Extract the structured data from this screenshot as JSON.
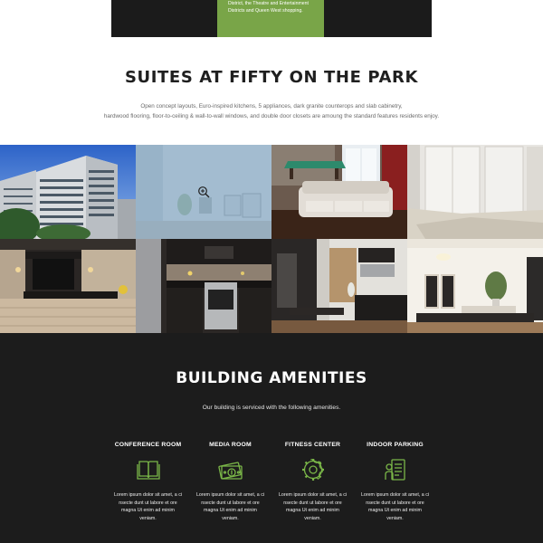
{
  "top_banner": {
    "text": "District, the Theatre and Entertainment Districts and Queen West shopping."
  },
  "suites": {
    "title": "SUITES AT FIFTY ON THE PARK",
    "description_line1": "Open concept layouts, Euro-inspired kitchens, 5 appliances, dark granite counterops and slab cabinetry,",
    "description_line2": "hardwood flooring, floor-to-ceiling & wall-to-wall windows, and double door closets are amoung the standard features residents enjoy."
  },
  "gallery": {
    "hover_icon": "zoom-in-icon",
    "photos": [
      {
        "subject": "building-exterior"
      },
      {
        "subject": "living-room-hover"
      },
      {
        "subject": "lounge-with-pool-table"
      },
      {
        "subject": "bedroom-closets"
      },
      {
        "subject": "kitchen-stone-wall"
      },
      {
        "subject": "kitchen-dark-cabinets"
      },
      {
        "subject": "open-kitchen-dining"
      },
      {
        "subject": "living-room-bright"
      }
    ]
  },
  "amenities": {
    "title": "BUILDING AMENITIES",
    "subtitle": "Our building is serviced with the following amenities.",
    "accent_color": "#7ab648",
    "items": [
      {
        "name": "CONFERENCE ROOM",
        "icon": "book-icon",
        "text": "Lorem ipsum dolor sit amet, a ci nsecte dunt ut labore et ore magna Ut enim ad minim veniam."
      },
      {
        "name": "MEDIA ROOM",
        "icon": "money-icon",
        "text": "Lorem ipsum dolor sit amet, a ci nsecte dunt ut labore et ore magna Ut enim ad minim veniam."
      },
      {
        "name": "FITNESS CENTER",
        "icon": "gear-icon",
        "text": "Lorem ipsum dolor sit amet, a ci nsecte dunt ut labore et ore magna Ut enim ad minim veniam."
      },
      {
        "name": "INDOOR PARKING",
        "icon": "parking-receipt-icon",
        "text": "Lorem ipsum dolor sit amet, a ci nsecte dunt ut labore et ore magna Ut enim ad minim veniam."
      }
    ]
  }
}
